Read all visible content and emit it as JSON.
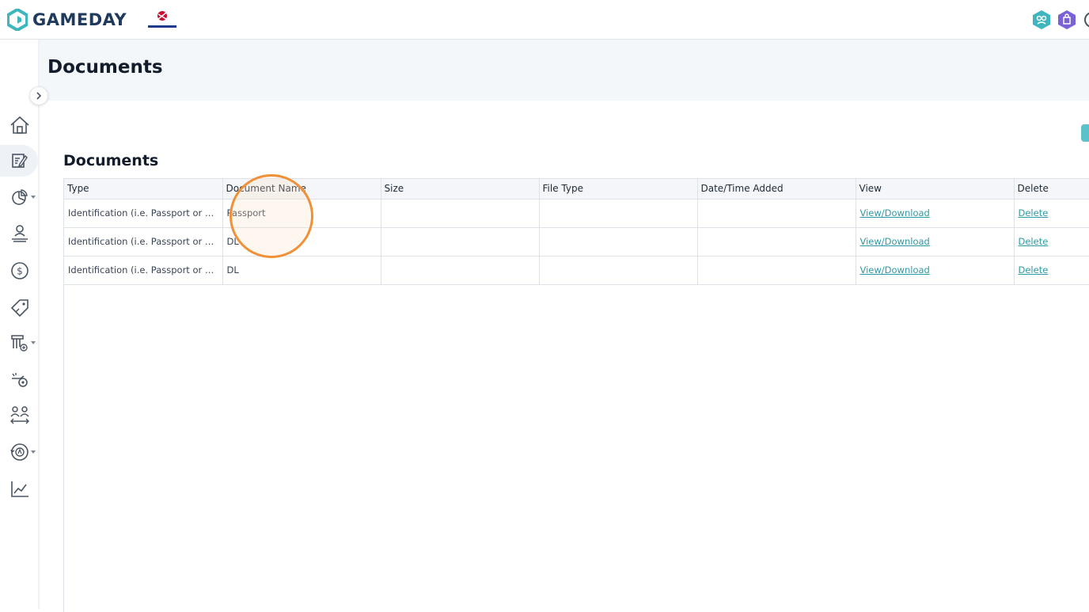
{
  "app": {
    "brand": "GAMEDAY",
    "org_logo_name": "ice-hockey-uk-logo"
  },
  "header": {
    "page_title": "Documents"
  },
  "sidebar": {
    "items": [
      {
        "icon": "home-icon"
      },
      {
        "icon": "edit-document-icon",
        "active": true
      },
      {
        "icon": "pie-chart-icon",
        "dropdown": true
      },
      {
        "icon": "user-hand-icon"
      },
      {
        "icon": "dollar-icon"
      },
      {
        "icon": "tag-icon"
      },
      {
        "icon": "trophy-settings-icon",
        "dropdown": true
      },
      {
        "icon": "whistle-icon"
      },
      {
        "icon": "team-transfer-icon"
      },
      {
        "icon": "rotate-icon",
        "dropdown": true
      },
      {
        "icon": "line-chart-icon"
      }
    ]
  },
  "section": {
    "title": "Documents"
  },
  "table": {
    "columns": [
      "Type",
      "Document Name",
      "Size",
      "File Type",
      "Date/Time Added",
      "View",
      "Delete"
    ],
    "rows": [
      {
        "type": "Identification (i.e. Passport or Birth Certificate)",
        "name": "Passport",
        "size": "",
        "file_type": "",
        "added": "",
        "view": "View/Download",
        "delete": "Delete"
      },
      {
        "type": "Identification (i.e. Passport or Birth Certificate)",
        "name": "DL",
        "size": "",
        "file_type": "",
        "added": "",
        "view": "View/Download",
        "delete": "Delete"
      },
      {
        "type": "Identification (i.e. Passport or Birth Certificate)",
        "name": "DL",
        "size": "",
        "file_type": "",
        "added": "",
        "view": "View/Download",
        "delete": "Delete"
      }
    ]
  },
  "colors": {
    "brand_teal": "#3fb6bd",
    "link": "#2f9aa3",
    "highlight": "#f0913a"
  }
}
